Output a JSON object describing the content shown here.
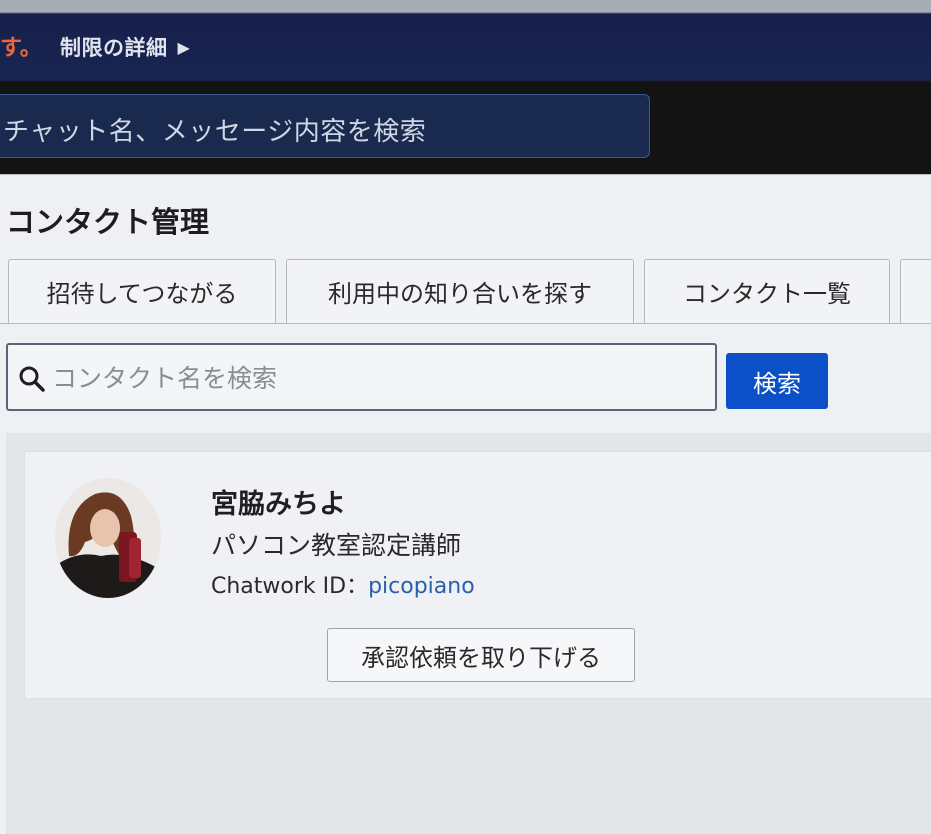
{
  "notice": {
    "trailing_text": "す。",
    "link_label": "制限の詳細",
    "link_arrow": "▶"
  },
  "chat_search": {
    "placeholder": "チャット名、メッセージ内容を検索"
  },
  "dialog": {
    "title": "コンタクト管理",
    "tabs": [
      {
        "label": "招待してつながる"
      },
      {
        "label": "利用中の知り合いを探す"
      },
      {
        "label": "コンタクト一覧"
      },
      {
        "label": ""
      }
    ],
    "contact_search": {
      "placeholder": "コンタクト名を検索",
      "button_label": "検索",
      "icon": "search-icon"
    },
    "result": {
      "name": "宮脇みちよ",
      "title": "パソコン教室認定講師",
      "id_label": "Chatwork ID：",
      "id_value": "picopiano",
      "action_label": "承認依頼を取り下げる"
    }
  },
  "colors": {
    "header_navy": "#1a2452",
    "primary_blue": "#0b50c6",
    "link_blue": "#2a5fb0",
    "notice_orange": "#e7683a"
  }
}
